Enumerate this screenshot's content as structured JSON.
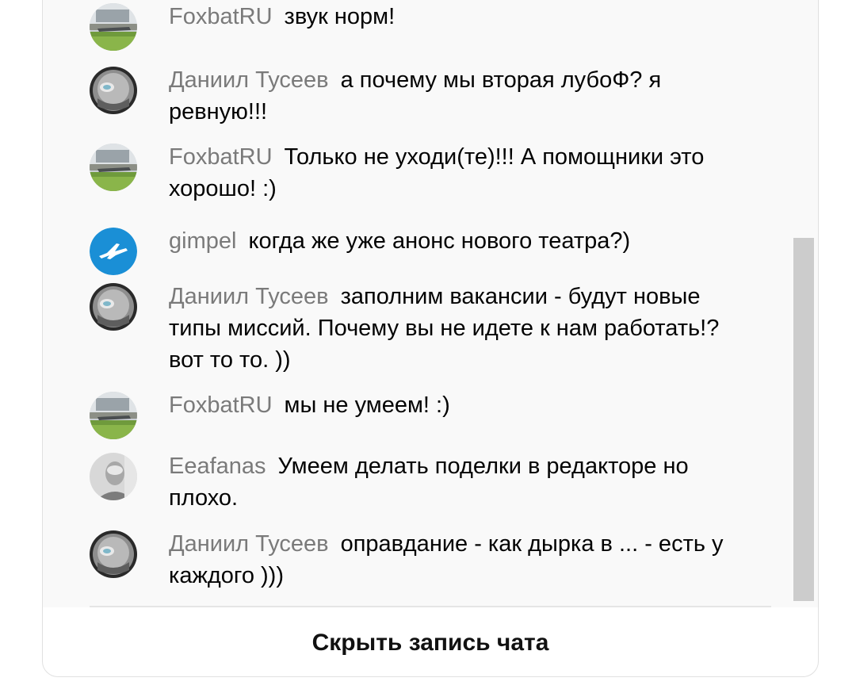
{
  "chat": {
    "messages": [
      {
        "author": "FoxbatRU",
        "text": "звук норм!",
        "avatar": "jet-on-runway-avatar"
      },
      {
        "author": "Даниил Тусеев",
        "text": "а почему мы вторая лубоФ? я ревную!!!",
        "avatar": "helmet-avatar"
      },
      {
        "author": "FoxbatRU",
        "text": "Только не уходи(те)!!! А помощники это хорошо! :)",
        "avatar": "jet-on-runway-avatar"
      },
      {
        "author": "gimpel",
        "text": "когда же уже анонс нового театра?)",
        "avatar": "plane-icon-avatar"
      },
      {
        "author": "Даниил Тусеев",
        "text": "заполним вакансии - будут новые типы миссий. Почему вы не идете к нам работать!? вот то то. ))",
        "avatar": "helmet-avatar"
      },
      {
        "author": "FoxbatRU",
        "text": "мы не умеем! :)",
        "avatar": "jet-on-runway-avatar"
      },
      {
        "author": "Eeafanas",
        "text": "Умеем делать поделки в редакторе но плохо.",
        "avatar": "portrait-photo-avatar"
      },
      {
        "author": "Даниил Тусеев",
        "text": "оправдание - как дырка в ... - есть у каждого )))",
        "avatar": "helmet-avatar"
      }
    ]
  },
  "footer": {
    "hide_chat_label": "Скрыть запись чата"
  },
  "colors": {
    "author": "#7a7a7a",
    "text": "#030303",
    "chat_background": "#f9f9f9",
    "scrollbar_thumb": "#cccccc",
    "gimpel_avatar": "#1a8fd6"
  }
}
